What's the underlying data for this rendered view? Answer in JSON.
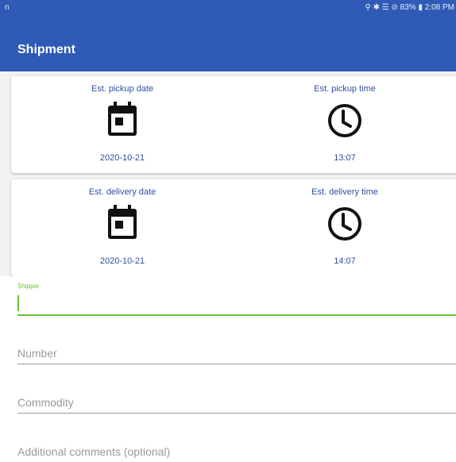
{
  "statusbar": {
    "left_icon": "n",
    "right_text": "⚲ ✱ ☰ ⊘ 83% ▮ 2:08 PM"
  },
  "appbar": {
    "title": "Shipment"
  },
  "pickup": {
    "date_label": "Est. pickup date",
    "date_value": "2020-10-21",
    "time_label": "Est. pickup time",
    "time_value": "13:07"
  },
  "delivery": {
    "date_label": "Est. delivery date",
    "date_value": "2020-10-21",
    "time_label": "Est. delivery time",
    "time_value": "14:07"
  },
  "form": {
    "shipper_label": "Shipper",
    "shipper_value": "",
    "number_placeholder": "Number",
    "commodity_placeholder": "Commodity",
    "comments_placeholder": "Additional comments (optional)"
  },
  "icons": {
    "calendar": "calendar-icon",
    "clock": "clock-icon"
  },
  "colors": {
    "primary": "#2f5bb7",
    "accent_text": "#2f4fa0",
    "active_field": "#6abf3c"
  }
}
